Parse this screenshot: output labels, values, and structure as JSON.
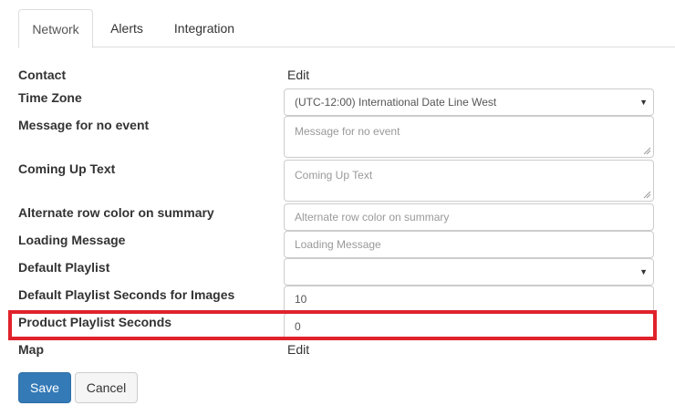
{
  "tabs": {
    "network": "Network",
    "alerts": "Alerts",
    "integration": "Integration"
  },
  "form": {
    "contact": {
      "label": "Contact",
      "value": "Edit"
    },
    "time_zone": {
      "label": "Time Zone",
      "value": "(UTC-12:00) International Date Line West"
    },
    "no_event_message": {
      "label": "Message for no event",
      "placeholder": "Message for no event"
    },
    "coming_up_text": {
      "label": "Coming Up Text",
      "placeholder": "Coming Up Text"
    },
    "alternate_row_color": {
      "label": "Alternate row color on summary",
      "placeholder": "Alternate row color on summary"
    },
    "loading_message": {
      "label": "Loading Message",
      "placeholder": "Loading Message"
    },
    "default_playlist": {
      "label": "Default Playlist",
      "value": ""
    },
    "default_playlist_seconds": {
      "label": "Default Playlist Seconds for Images",
      "value": "10"
    },
    "product_playlist_seconds": {
      "label": "Product Playlist Seconds",
      "value": "0"
    },
    "map": {
      "label": "Map",
      "value": "Edit"
    }
  },
  "buttons": {
    "save": "Save",
    "cancel": "Cancel"
  },
  "colors": {
    "primary": "#337ab7",
    "highlight": "#e0222b",
    "border": "#cccccc"
  },
  "icons": {
    "dropdown": "chevron-down-icon",
    "resize": "resize-grip-icon"
  }
}
